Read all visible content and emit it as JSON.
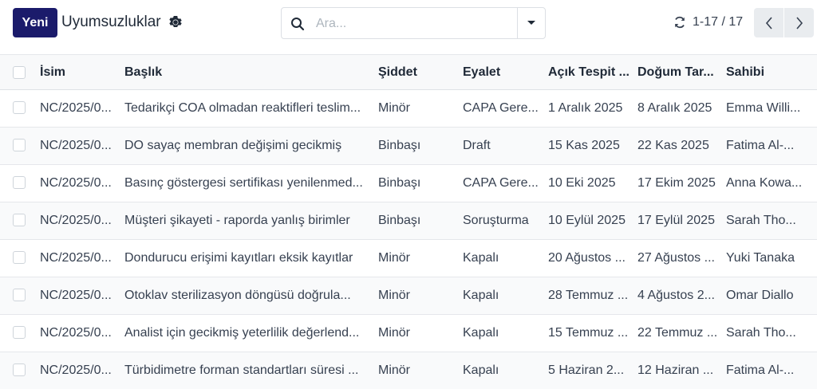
{
  "control_panel": {
    "new_button": "Yeni",
    "title": "Uyumsuzluklar",
    "search_placeholder": "Ara...",
    "pager_value": "1-17 / 17"
  },
  "table": {
    "headers": {
      "name": "İsim",
      "title": "Başlık",
      "severity": "Şiddet",
      "state": "Eyalet",
      "open_date": "Açık Tespit ...",
      "due_date": "Doğum Tar...",
      "owner": "Sahibi"
    },
    "rows": [
      {
        "name": "NC/2025/0...",
        "title": "Tedarikçi COA olmadan reaktifleri teslim...",
        "severity": "Minör",
        "state": "CAPA Gere...",
        "open_date": "1 Aralık 2025",
        "due_date": "8 Aralık 2025",
        "owner": "Emma Willi..."
      },
      {
        "name": "NC/2025/0...",
        "title": "DO sayaç membran değişimi gecikmiş",
        "severity": "Binbaşı",
        "state": "Draft",
        "open_date": "15 Kas 2025",
        "due_date": "22 Kas 2025",
        "owner": "Fatima Al-..."
      },
      {
        "name": "NC/2025/0...",
        "title": "Basınç göstergesi sertifikası yenilenmed...",
        "severity": "Binbaşı",
        "state": "CAPA Gere...",
        "open_date": "10 Eki 2025",
        "due_date": "17 Ekim 2025",
        "owner": "Anna Kowa..."
      },
      {
        "name": "NC/2025/0...",
        "title": "Müşteri şikayeti - raporda yanlış birimler",
        "severity": "Binbaşı",
        "state": "Soruşturma",
        "open_date": "10 Eylül 2025",
        "due_date": "17 Eylül 2025",
        "owner": "Sarah Tho..."
      },
      {
        "name": "NC/2025/0...",
        "title": "Dondurucu erişimi kayıtları eksik kayıtlar",
        "severity": "Minör",
        "state": "Kapalı",
        "open_date": "20 Ağustos ...",
        "due_date": "27 Ağustos ...",
        "owner": "Yuki Tanaka"
      },
      {
        "name": "NC/2025/0...",
        "title": "Otoklav sterilizasyon döngüsü doğrula...",
        "severity": "Minör",
        "state": "Kapalı",
        "open_date": "28 Temmuz ...",
        "due_date": "4 Ağustos 2...",
        "owner": "Omar Diallo"
      },
      {
        "name": "NC/2025/0...",
        "title": "Analist için gecikmiş yeterlilik değerlend...",
        "severity": "Minör",
        "state": "Kapalı",
        "open_date": "15 Temmuz ...",
        "due_date": "22 Temmuz ...",
        "owner": "Sarah Tho..."
      },
      {
        "name": "NC/2025/0...",
        "title": "Türbidimetre forman standartları süresi ...",
        "severity": "Minör",
        "state": "Kapalı",
        "open_date": "5 Haziran 2...",
        "due_date": "12 Haziran ...",
        "owner": "Fatima Al-..."
      }
    ]
  },
  "colors": {
    "primary": "#1b1b6b",
    "header_bg": "#f8f9fa",
    "border": "#e5e7eb"
  },
  "icons": [
    "gear-icon",
    "search-icon",
    "caret-down-icon",
    "refresh-icon",
    "chevron-left-icon",
    "chevron-right-icon"
  ]
}
